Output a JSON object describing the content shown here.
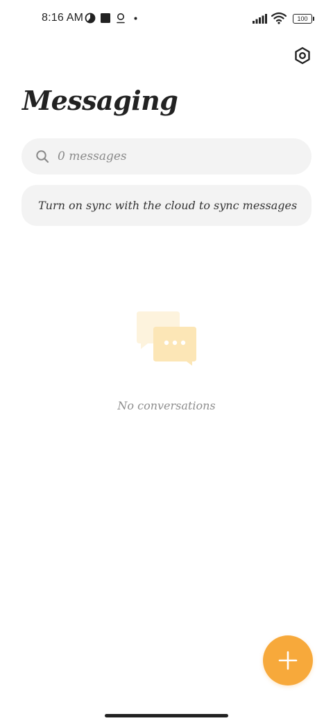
{
  "status_bar": {
    "time": "8:16 AM",
    "battery": "100",
    "icons": [
      "data-saver-icon",
      "square-notification-icon",
      "location-pin-icon",
      "dot-icon",
      "signal-icon",
      "wifi-icon",
      "battery-icon"
    ]
  },
  "header": {
    "title": "Messaging",
    "settings_icon": "gear-icon"
  },
  "search": {
    "placeholder": "0 messages",
    "icon": "search-icon"
  },
  "sync_banner": {
    "text": "Turn on sync with the cloud to sync messages",
    "icon": "chevron-right-icon"
  },
  "empty_state": {
    "icon": "chat-bubbles-icon",
    "text": "No conversations"
  },
  "fab": {
    "icon": "plus-icon"
  },
  "colors": {
    "accent": "#f7a93b",
    "bubble_light": "#fdf3dd",
    "bubble_mid": "#fce6b6",
    "card_bg": "#f3f3f3",
    "text_primary": "#222222",
    "text_secondary": "#8e8e8e"
  }
}
